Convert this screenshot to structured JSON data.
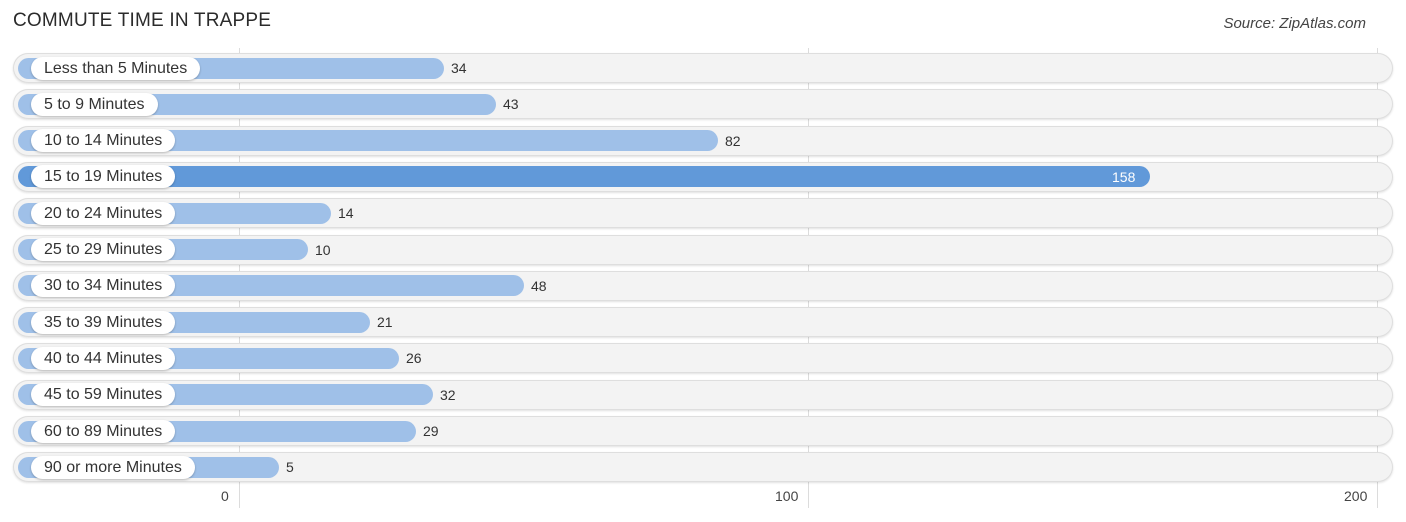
{
  "chart_data": {
    "type": "bar",
    "orientation": "horizontal",
    "title": "COMMUTE TIME IN TRAPPE",
    "source": "Source: ZipAtlas.com",
    "categories": [
      "Less than 5 Minutes",
      "5 to 9 Minutes",
      "10 to 14 Minutes",
      "15 to 19 Minutes",
      "20 to 24 Minutes",
      "25 to 29 Minutes",
      "30 to 34 Minutes",
      "35 to 39 Minutes",
      "40 to 44 Minutes",
      "45 to 59 Minutes",
      "60 to 89 Minutes",
      "90 or more Minutes"
    ],
    "values": [
      34,
      43,
      82,
      158,
      14,
      10,
      48,
      21,
      26,
      32,
      29,
      5
    ],
    "highlight_index": 3,
    "xlabel": "",
    "ylabel": "",
    "xlim": [
      0,
      200
    ],
    "x_ticks": [
      "0",
      "100",
      "200"
    ],
    "grid": true,
    "colors": {
      "bar": "#9fc0e8",
      "highlight": "#6199d9",
      "track": "#f3f3f3"
    }
  }
}
